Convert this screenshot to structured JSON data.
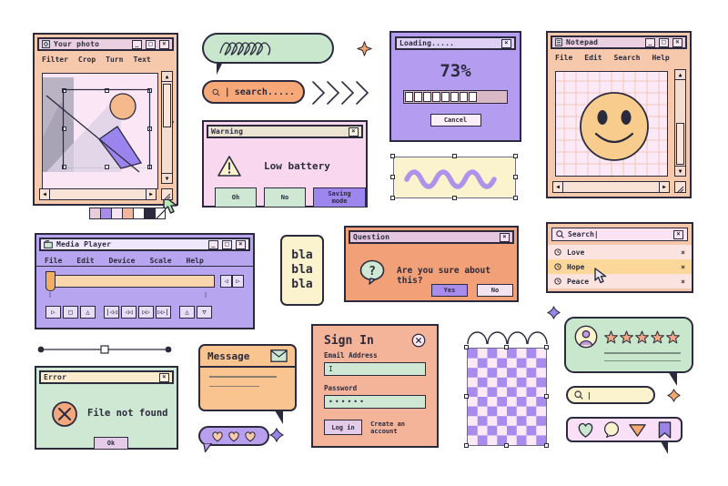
{
  "photo_editor": {
    "title": "Your photo",
    "icon": "image-icon",
    "menus": [
      "Filter",
      "Crop",
      "Turn",
      "Text"
    ],
    "window_buttons": [
      "minimize",
      "maximize",
      "close"
    ],
    "bg": "#f7c9ac",
    "titlebar_bg": "#e9cfe0",
    "palette": [
      "#e8cdd8",
      "#a98ce8",
      "#f6e4f2",
      "#f2b79b",
      "#ffffff",
      "#2b2b3d"
    ],
    "cursor": "arrow-cursor"
  },
  "squiggle_bubble": {
    "name": "squiggle-speech-bubble",
    "bg": "#c9e7cd"
  },
  "sparkle_top": {
    "name": "sparkle-icon",
    "color": "#f2a86e"
  },
  "search_pill": {
    "icon": "search-icon",
    "caret": "|",
    "text": "search.....",
    "bg": "#f7a878"
  },
  "chevrons": {
    "name": "chevron-arrows",
    "count": 4,
    "color": "#2b2b3d"
  },
  "warning_dialog": {
    "title": "Warning",
    "icon": "warning-triangle-icon",
    "message": "Low battery",
    "buttons": [
      {
        "label": "Oh",
        "style": "normal"
      },
      {
        "label": "No",
        "style": "normal"
      },
      {
        "label": "Saving mode",
        "style": "primary"
      }
    ],
    "bg": "#f9d8ef",
    "titlebar_bg": "#ece4d2",
    "primary_color": "#9e86ef"
  },
  "loading_dialog": {
    "title": "Loading.....",
    "percent": "73%",
    "progress_value": 73,
    "progress_cells_total": 11,
    "progress_cells_filled": 8,
    "button": "Cancel",
    "bg": "#b49cf0",
    "titlebar_bg": "#ded0f5"
  },
  "notepad": {
    "title": "Notepad",
    "icon": "notepad-icon",
    "menus": [
      "File",
      "Edit",
      "Search",
      "Help"
    ],
    "content": "smiley-face-drawing",
    "bg": "#f7c9ac",
    "titlebar_bg": "#e9cfe0",
    "face_color": "#f7cc8d"
  },
  "wave_box": {
    "name": "wave-graphic-selection",
    "bg": "#fbf3cd",
    "wave_color": "#ae93ea"
  },
  "media_player": {
    "title": "Media Player",
    "icon": "media-clapper-icon",
    "menus": [
      "File",
      "Edit",
      "Device",
      "Scale",
      "Help"
    ],
    "transport": [
      "play",
      "stop",
      "eject",
      "prev-track",
      "rewind",
      "fast-forward",
      "next-track",
      "volume-up",
      "volume-down"
    ],
    "nav_buttons": [
      "prev",
      "next"
    ],
    "bg": "#b8a5f0",
    "titlebar_bg": "#efe7fb",
    "track_color": "#f9d6ab"
  },
  "bla_bubble": {
    "lines": [
      "bla",
      "bla",
      "bla"
    ],
    "bg": "#fbf3cd"
  },
  "question_dialog": {
    "title": "Question",
    "icon": "question-mark-bubble-icon",
    "message": "Are you sure about this?",
    "buttons": [
      {
        "label": "Yes",
        "style": "primary"
      },
      {
        "label": "No",
        "style": "normal"
      }
    ],
    "bg": "#f2a077",
    "titlebar_bg": "#e5c6e0",
    "primary_color": "#a78ced"
  },
  "search_list": {
    "search_icon": "search-icon",
    "value": "Search",
    "caret": "|",
    "clear_button": "×",
    "items": [
      {
        "label": "Love",
        "highlighted": false
      },
      {
        "label": "Hope",
        "highlighted": true
      },
      {
        "label": "Peace",
        "highlighted": false
      }
    ],
    "remove_label": "×",
    "cursor": "arrow-cursor",
    "bg": "#f6c6a8",
    "highlight_color": "#fcd79a"
  },
  "line_slider": {
    "name": "path-slider",
    "handle": "square-handle"
  },
  "error_dialog": {
    "title": "Error",
    "icon": "error-circle-x-icon",
    "message": "File not found",
    "button": "Ok",
    "bg": "#cfe8d3",
    "titlebar_bg": "#fbeccd",
    "button_bg": "#e4cbe8"
  },
  "message_bubble": {
    "title": "Message",
    "icon": "envelope-icon",
    "lines": 2,
    "bg": "#f9c48f"
  },
  "hearts_bubble": {
    "name": "hearts-reaction-bubble",
    "hearts": 3,
    "bg": "#b8a0ef"
  },
  "flower_sparkle": {
    "name": "flower-sparkle-icon",
    "color": "#9a84e8"
  },
  "sign_in": {
    "title": "Sign In",
    "close_label": "×",
    "email_label": "Email Address",
    "email_value": "",
    "email_caret": "I",
    "password_label": "Password",
    "password_value": "••••••",
    "submit_label": "Log in",
    "secondary_label": "Create an account",
    "bg": "#f3b49a",
    "input_bg": "#cfe8d3"
  },
  "arcs": {
    "name": "arc-decoration",
    "count": 4
  },
  "checkerboard": {
    "name": "checkerboard-pattern-selection",
    "colors": [
      "#a78ced",
      "#fbeaf6"
    ],
    "cols": 8,
    "rows": 10
  },
  "review_bubble": {
    "avatar": "user-avatar-icon",
    "stars": 5,
    "star_color": "#f3a882",
    "text_lines": 2,
    "bg": "#c9e7cd"
  },
  "small_search_bubble": {
    "icon": "search-icon",
    "caret": "|",
    "bg": "#fbf3cd"
  },
  "social_bubble": {
    "icons": [
      "heart-icon",
      "comment-icon",
      "send-icon",
      "bookmark-icon"
    ],
    "bg": "#f9e0f7",
    "heart_color": "#c9e7cd",
    "comment_color": "#fbf3cd",
    "send_color": "#f2a86e",
    "bookmark_color": "#9a84e8"
  },
  "sparkle_right": {
    "name": "sparkle-icon",
    "color": "#f2a86e"
  },
  "sparkle_mid": {
    "name": "sparkle-icon",
    "color": "#9a84e8"
  }
}
